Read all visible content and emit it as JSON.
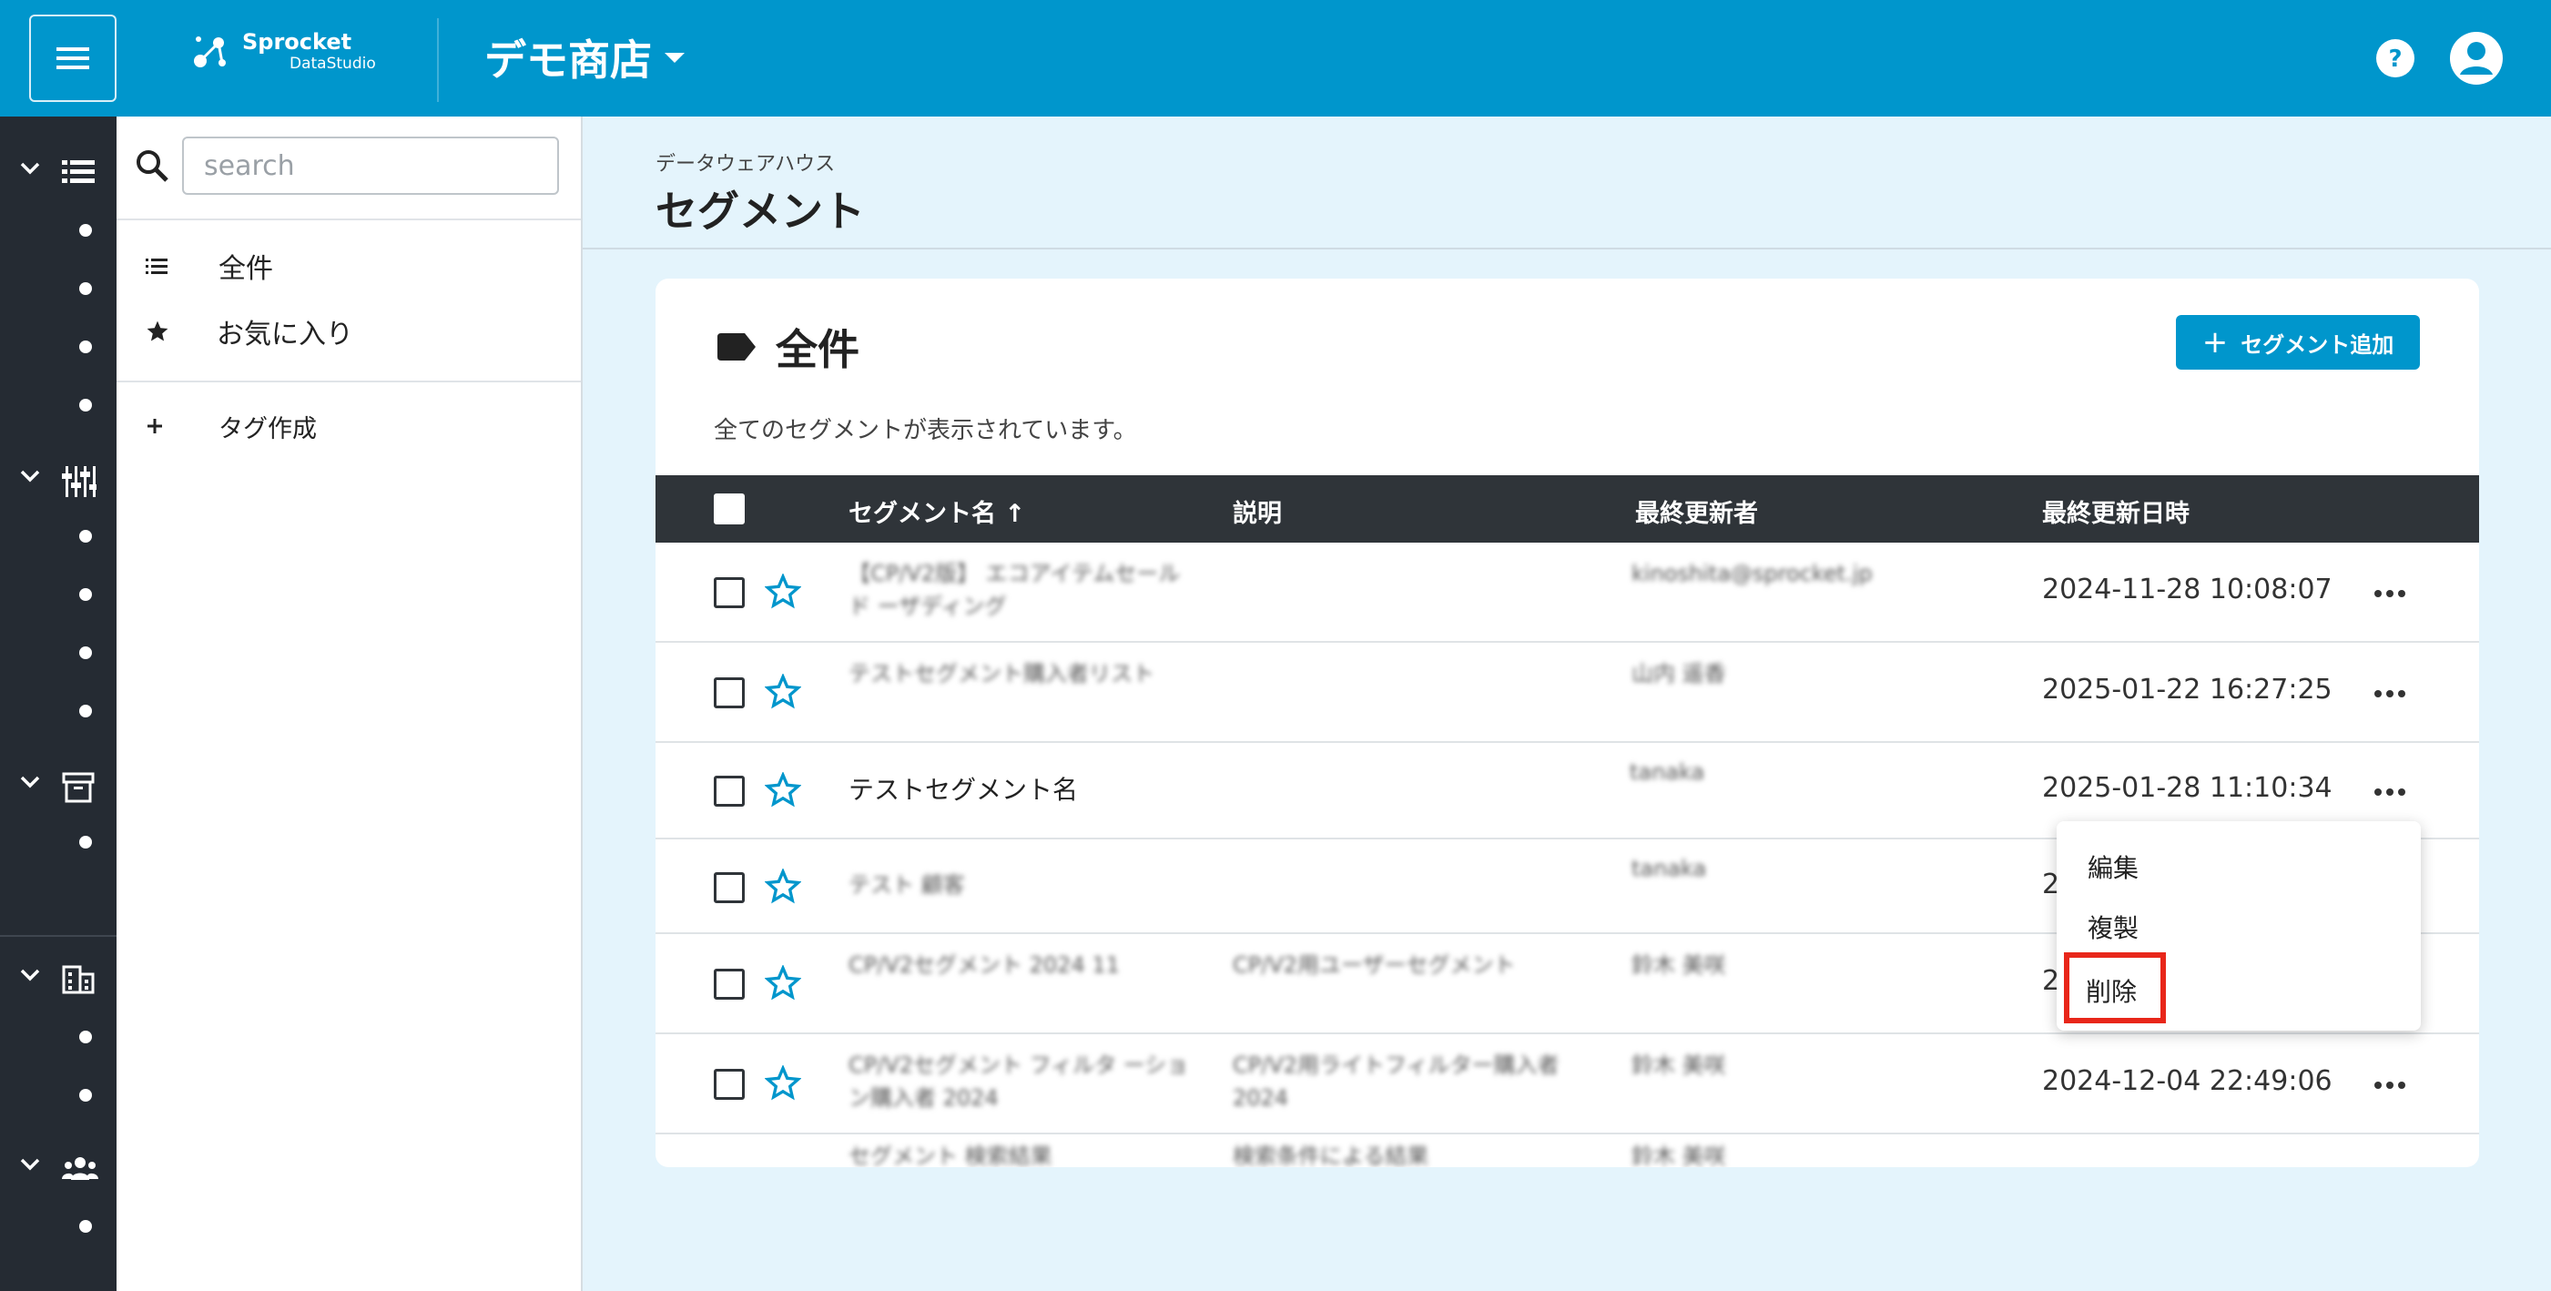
{
  "header": {
    "logo_main": "Sprocket",
    "logo_sub": "DataStudio",
    "store_name": "デモ商店"
  },
  "sidebar": {
    "search": {
      "placeholder": "search",
      "value": ""
    },
    "items": [
      {
        "label": "全件",
        "icon": "list-icon"
      },
      {
        "label": "お気に入り",
        "icon": "star-icon"
      }
    ],
    "create_tag": "タグ作成"
  },
  "page": {
    "breadcrumb": "データウェアハウス",
    "title": "セグメント"
  },
  "card": {
    "title": "全件",
    "description": "全てのセグメントが表示されています。",
    "add_button": "セグメント追加"
  },
  "table": {
    "columns": [
      "セグメント名 ↑",
      "説明",
      "最終更新者",
      "最終更新日時"
    ],
    "rows": [
      {
        "name": "【CP/V2版】 エコアイテムセールド ーザディング",
        "description": "",
        "updater": "kinoshita@sprocket.jp ",
        "date": "2024-11-28 10:08:07"
      },
      {
        "name": "テストセグメント購入者リスト",
        "description": "",
        "updater": "山内 遥香 ",
        "date": "2025-01-22 16:27:25"
      },
      {
        "name": "テストセグメント名",
        "description": "",
        "updater": "tanaka ",
        "date": "2025-01-28 11:10:34"
      },
      {
        "name": "テスト 顧客",
        "description": "",
        "updater": "tanaka ",
        "date": "2"
      },
      {
        "name": "CP/V2セグメント 2024 11",
        "description": "CP/V2用ユーザーセグメント",
        "updater": "鈴木 美咲 ",
        "date": "2"
      },
      {
        "name": "CP/V2セグメント フィルタ ーション購入者 2024",
        "description": "CP/V2用ライトフィルター購入者 2024",
        "updater": "鈴木 美咲 ",
        "date": "2024-12-04 22:49:06"
      },
      {
        "name": "セグメント 検索結果",
        "description": "検索条件による結果",
        "updater": "鈴木 美咲",
        "date": ""
      }
    ]
  },
  "context_menu": {
    "items": [
      "編集",
      "複製",
      "削除"
    ]
  },
  "colors": {
    "brand": "#0096cc",
    "rail": "#252b33",
    "table_header": "#2f3439",
    "highlight": "#e8261a",
    "page_bg": "#e4f4fc"
  }
}
